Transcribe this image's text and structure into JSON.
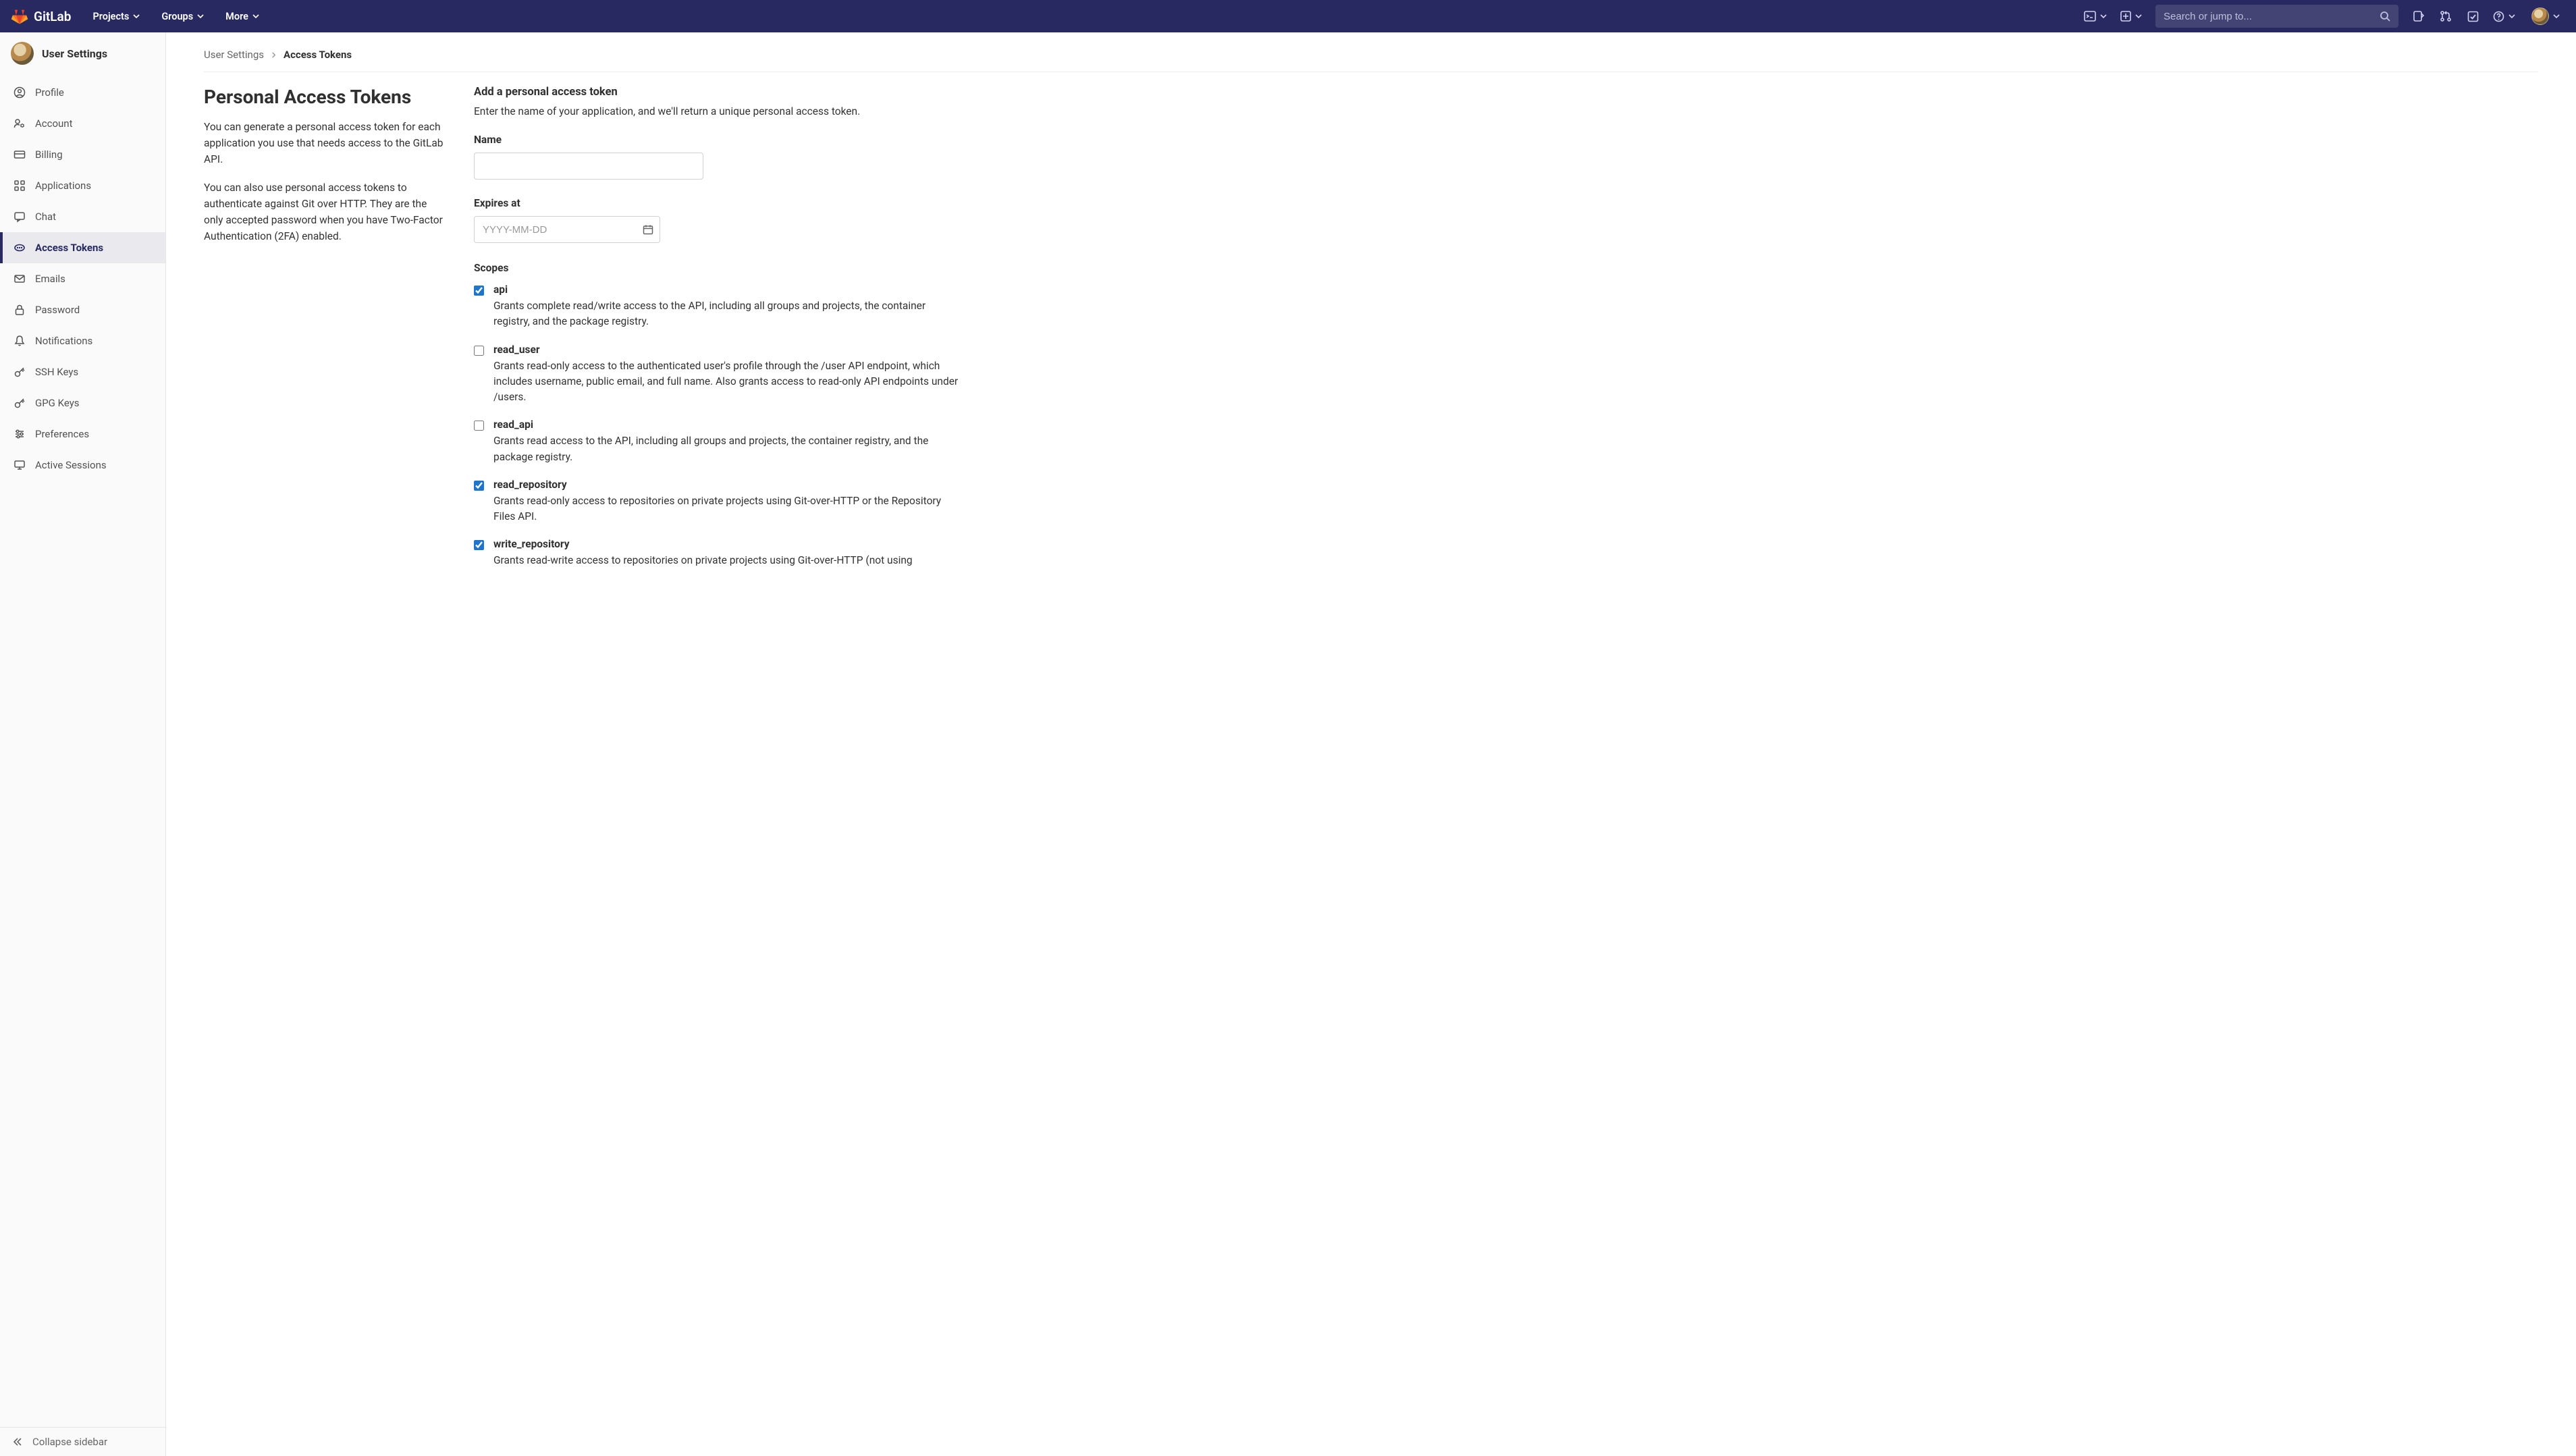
{
  "brand": "GitLab",
  "topnav": {
    "items": [
      {
        "label": "Projects"
      },
      {
        "label": "Groups"
      },
      {
        "label": "More"
      }
    ],
    "search_placeholder": "Search or jump to..."
  },
  "sidebar": {
    "title": "User Settings",
    "items": [
      {
        "label": "Profile",
        "icon": "user-circle"
      },
      {
        "label": "Account",
        "icon": "account-cog"
      },
      {
        "label": "Billing",
        "icon": "credit-card"
      },
      {
        "label": "Applications",
        "icon": "apps"
      },
      {
        "label": "Chat",
        "icon": "chat"
      },
      {
        "label": "Access Tokens",
        "icon": "token",
        "active": true
      },
      {
        "label": "Emails",
        "icon": "mail"
      },
      {
        "label": "Password",
        "icon": "lock"
      },
      {
        "label": "Notifications",
        "icon": "bell"
      },
      {
        "label": "SSH Keys",
        "icon": "key"
      },
      {
        "label": "GPG Keys",
        "icon": "key"
      },
      {
        "label": "Preferences",
        "icon": "sliders"
      },
      {
        "label": "Active Sessions",
        "icon": "monitor"
      }
    ],
    "collapse_label": "Collapse sidebar"
  },
  "breadcrumb": {
    "root": "User Settings",
    "current": "Access Tokens"
  },
  "page": {
    "title": "Personal Access Tokens",
    "desc1": "You can generate a personal access token for each application you use that needs access to the GitLab API.",
    "desc2": "You can also use personal access tokens to authenticate against Git over HTTP. They are the only accepted password when you have Two-Factor Authentication (2FA) enabled."
  },
  "form": {
    "header": "Add a personal access token",
    "header_desc": "Enter the name of your application, and we'll return a unique personal access token.",
    "name_label": "Name",
    "name_value": "",
    "expires_label": "Expires at",
    "expires_placeholder": "YYYY-MM-DD",
    "scopes_label": "Scopes",
    "scopes": [
      {
        "name": "api",
        "checked": true,
        "desc": "Grants complete read/write access to the API, including all groups and projects, the container registry, and the package registry."
      },
      {
        "name": "read_user",
        "checked": false,
        "desc": "Grants read-only access to the authenticated user's profile through the /user API endpoint, which includes username, public email, and full name. Also grants access to read-only API endpoints under /users."
      },
      {
        "name": "read_api",
        "checked": false,
        "desc": "Grants read access to the API, including all groups and projects, the container registry, and the package registry."
      },
      {
        "name": "read_repository",
        "checked": true,
        "desc": "Grants read-only access to repositories on private projects using Git-over-HTTP or the Repository Files API."
      },
      {
        "name": "write_repository",
        "checked": true,
        "desc": "Grants read-write access to repositories on private projects using Git-over-HTTP (not using"
      }
    ]
  }
}
